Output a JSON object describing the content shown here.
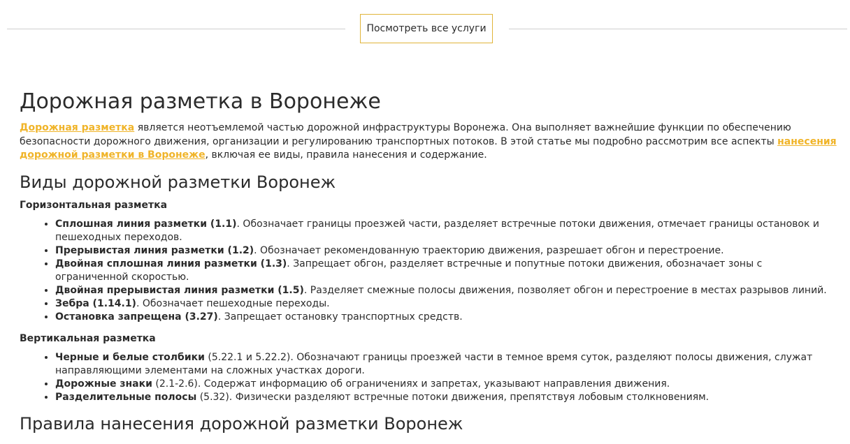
{
  "top": {
    "button_label": "Посмотреть все услуги"
  },
  "article": {
    "title": "Дорожная разметка в Воронеже",
    "intro": {
      "link1": "Дорожная разметка",
      "text1": " является неотъемлемой частью дорожной инфраструктуры Воронежа. Она выполняет важнейшие функции по обеспечению безопасности дорожного движения, организации и регулированию транспортных потоков. В этой статье мы подробно рассмотрим все аспекты ",
      "link2": "нанесения дорожной разметки в Воронеже",
      "text2": ", включая ее виды, правила нанесения и содержание."
    },
    "section1": {
      "title": "Виды дорожной разметки Воронеж",
      "horizontal": {
        "title": "Горизонтальная разметка",
        "items": [
          {
            "term": "Сплошная линия разметки (1.1)",
            "desc": ". Обозначает границы проезжей части, разделяет встречные потоки движения, отмечает границы остановок и пешеходных переходов."
          },
          {
            "term": "Прерывистая линия разметки (1.2)",
            "desc": ". Обозначает рекомендованную траекторию движения, разрешает обгон и перестроение."
          },
          {
            "term": "Двойная сплошная линия разметки (1.3)",
            "desc": ". Запрещает обгон, разделяет встречные и попутные потоки движения, обозначает зоны с ограниченной скоростью."
          },
          {
            "term": "Двойная прерывистая линия разметки (1.5)",
            "desc": ". Разделяет смежные полосы движения, позволяет обгон и перестроение в местах разрывов линий."
          },
          {
            "term": "Зебра (1.14.1)",
            "desc": ". Обозначает пешеходные переходы."
          },
          {
            "term": "Остановка запрещена (3.27)",
            "desc": ". Запрещает остановку транспортных средств."
          }
        ]
      },
      "vertical": {
        "title": "Вертикальная разметка",
        "items": [
          {
            "term": "Черные и белые столбики",
            "desc": " (5.22.1 и 5.22.2). Обозначают границы проезжей части в темное время суток, разделяют полосы движения, служат направляющими элементами на сложных участках дороги."
          },
          {
            "term": "Дорожные знаки",
            "desc": " (2.1-2.6). Содержат информацию об ограничениях и запретах, указывают направления движения."
          },
          {
            "term": "Разделительные полосы",
            "desc": " (5.32). Физически разделяют встречные потоки движения, препятствуя лобовым столкновениям."
          }
        ]
      }
    },
    "section2": {
      "title": "Правила нанесения дорожной разметки Воронеж"
    }
  }
}
